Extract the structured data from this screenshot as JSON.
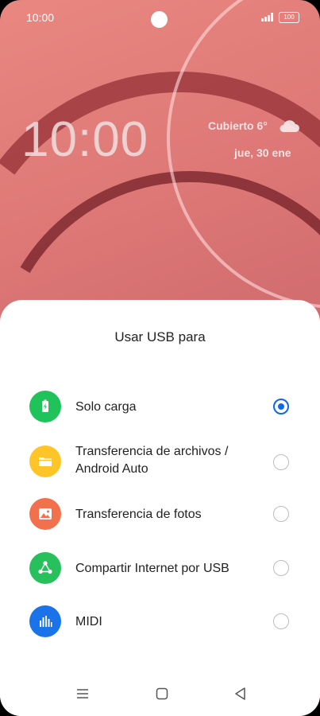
{
  "status_bar": {
    "time": "10:00",
    "battery": "100"
  },
  "lock_screen": {
    "clock": "10:00",
    "weather": "Cubierto 6°",
    "date": "jue, 30 ene",
    "weather_icon": "cloud-icon"
  },
  "sheet": {
    "title": "Usar USB para",
    "options": [
      {
        "label": "Solo carga",
        "icon": "battery-charging-icon",
        "icon_color": "#1fc35a",
        "selected": true
      },
      {
        "label": "Transferencia de archivos / Android Auto",
        "icon": "folder-icon",
        "icon_color": "#ffc425",
        "selected": false
      },
      {
        "label": "Transferencia de fotos",
        "icon": "image-icon",
        "icon_color": "#f2704b",
        "selected": false
      },
      {
        "label": "Compartir Internet por USB",
        "icon": "share-network-icon",
        "icon_color": "#28c05c",
        "selected": false
      },
      {
        "label": "MIDI",
        "icon": "music-equalizer-icon",
        "icon_color": "#1a73e8",
        "selected": false
      }
    ]
  },
  "nav_bar": {
    "buttons": [
      "menu-icon",
      "home-icon",
      "back-icon"
    ]
  },
  "colors": {
    "accent": "#0b6ae8"
  }
}
